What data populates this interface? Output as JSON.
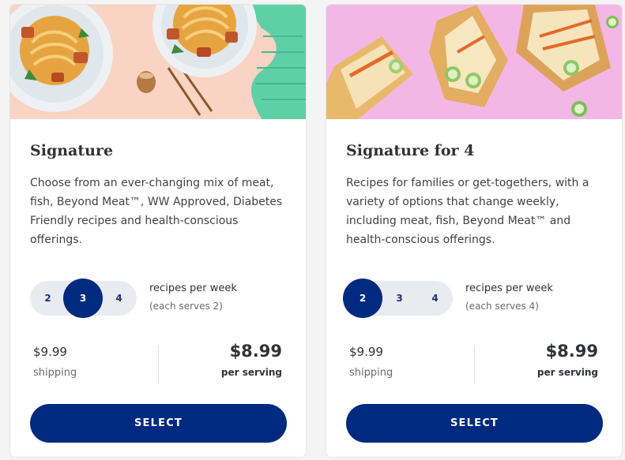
{
  "colors": {
    "accent": "#002a80",
    "stepper_bg": "#e9ebf0",
    "left_image_bg": "#f9d3c3",
    "right_image_bg": "#f3b7e6"
  },
  "plans": [
    {
      "title": "Signature",
      "description": "Choose from an ever-changing mix of meat, fish, Beyond Meat™, WW Approved, Diabetes Friendly recipes and health-conscious offerings.",
      "image_icon": "noodle-bowls-image",
      "recipe_options": [
        "2",
        "3",
        "4"
      ],
      "selected_option": "3",
      "recipes_label": "recipes per week",
      "serves_label": "(each serves 2)",
      "shipping_price": "$9.99",
      "shipping_label": "shipping",
      "price": "$8.99",
      "price_label": "per serving",
      "button_label": "SELECT"
    },
    {
      "title": "Signature for 4",
      "description": "Recipes for families or get-togethers, with a variety of options that change weekly, including meat, fish, Beyond Meat™ and health-conscious offerings.",
      "image_icon": "sandwiches-image",
      "recipe_options": [
        "2",
        "3",
        "4"
      ],
      "selected_option": "2",
      "recipes_label": "recipes per week",
      "serves_label": "(each serves 4)",
      "shipping_price": "$9.99",
      "shipping_label": "shipping",
      "price": "$8.99",
      "price_label": "per serving",
      "button_label": "SELECT"
    }
  ]
}
